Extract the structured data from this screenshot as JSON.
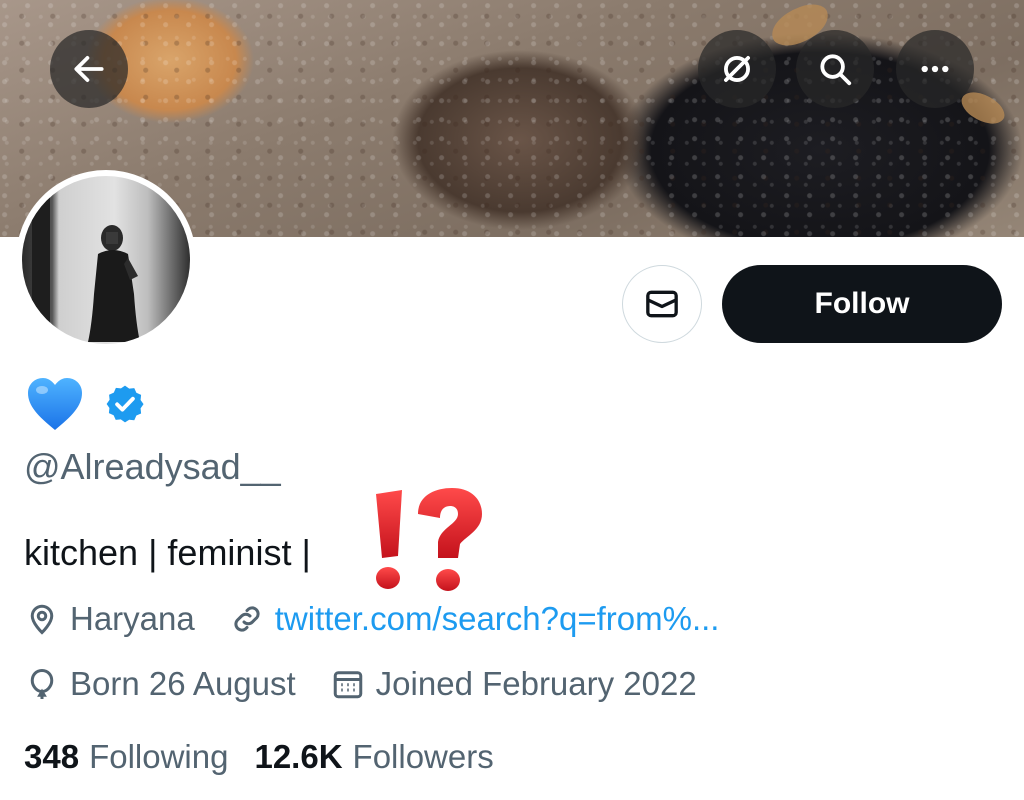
{
  "header": {
    "back_icon": "arrow-left-icon",
    "translate_icon": "no-symbol-icon",
    "search_icon": "search-icon",
    "more_icon": "more-horizontal-icon"
  },
  "profile": {
    "name_emoji": "blue-heart",
    "verified_icon": "verified-badge-icon",
    "handle": "@Alreadysad__",
    "bio": "kitchen | feminist |",
    "bio_reaction": "interrobang-icon",
    "location": "Haryana",
    "website": "twitter.com/search?q=from%...",
    "born": "Born 26 August",
    "joined": "Joined February 2022",
    "following_count": "348",
    "following_label": "Following",
    "followers_count": "12.6K",
    "followers_label": "Followers"
  },
  "actions": {
    "follow_label": "Follow",
    "message_icon": "envelope-icon"
  },
  "colors": {
    "accent": "#1d9bf0",
    "follow_bg": "#0f1419",
    "secondary_text": "#536471",
    "interrobang": "#e0202a"
  }
}
